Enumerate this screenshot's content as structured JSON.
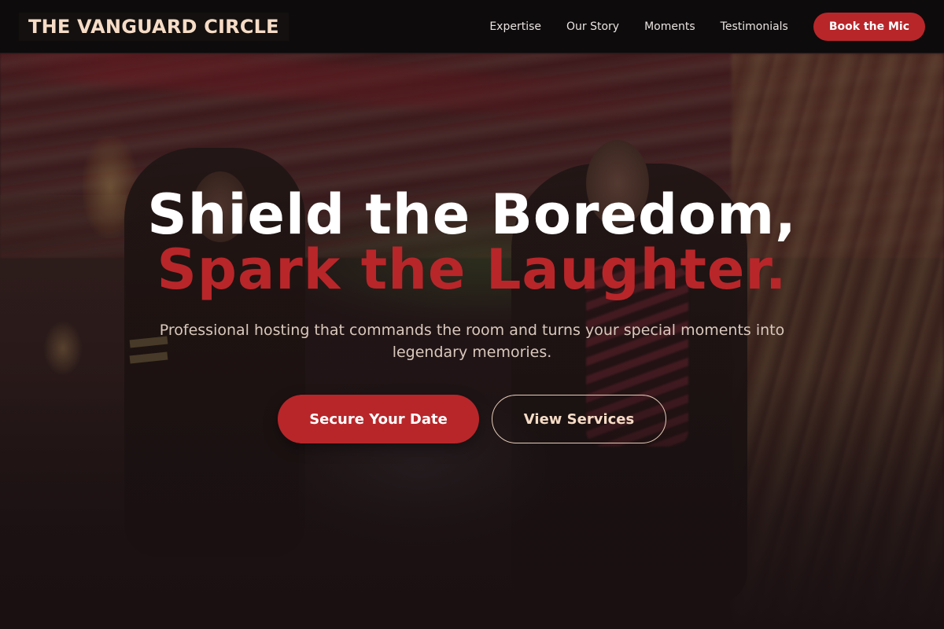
{
  "header": {
    "brand": "THE VANGUARD CIRCLE",
    "nav": [
      {
        "label": "Expertise"
      },
      {
        "label": "Our Story"
      },
      {
        "label": "Moments"
      },
      {
        "label": "Testimonials"
      }
    ],
    "cta_label": "Book the Mic"
  },
  "hero": {
    "headline_line1": "Shield the Boredom,",
    "headline_line2": "Spark the Laughter.",
    "subtitle": "Professional hosting that commands the room and turns your special moments into legendary memories.",
    "primary_cta": "Secure Your Date",
    "secondary_cta": "View Services"
  },
  "colors": {
    "accent": "#b8262a",
    "brand_text": "#f6dcc6",
    "header_bg": "#0e0b0c",
    "page_bg": "#1a1012"
  },
  "icons": []
}
